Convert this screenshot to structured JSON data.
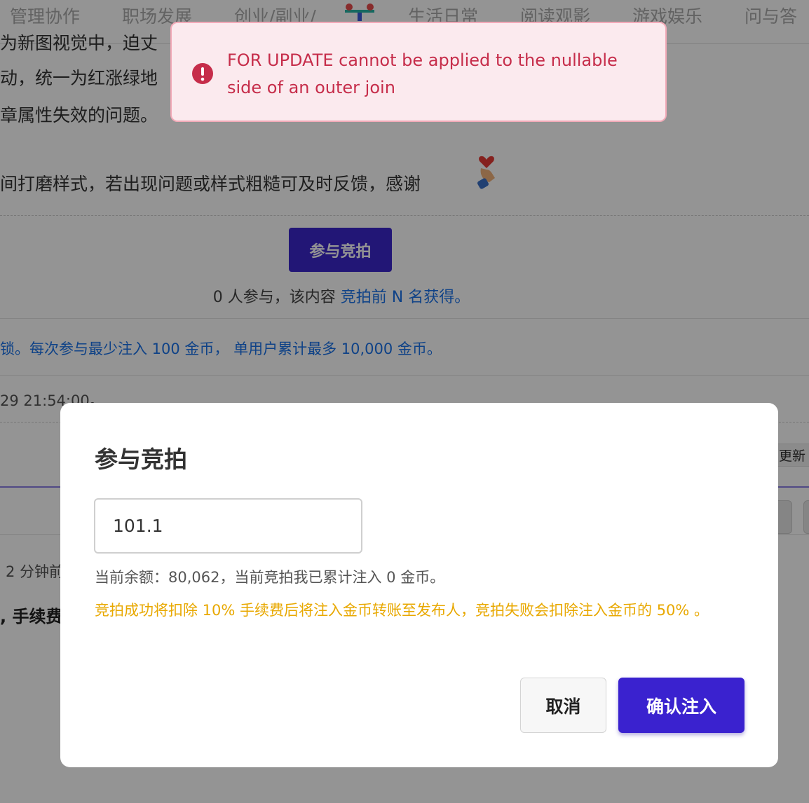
{
  "nav": {
    "items": [
      "管理协作",
      "职场发展",
      "创业/副业/",
      "生活日常",
      "阅读观影",
      "游戏娱乐",
      "问与答"
    ]
  },
  "article": {
    "line1": "为新图视觉中，迫丈",
    "line2": "动，统一为红涨绿地",
    "line3": "章属性失效的问题。",
    "line4": "间打磨样式，若出现问题或样式粗糙可及时反馈，感谢",
    "emoji": "heart-hand-icon"
  },
  "auction": {
    "button_label": "参与竞拍",
    "participants_prefix": "0 人参与，该内容",
    "participants_link": "竞拍前 N 名获得。",
    "rules": "锁。每次参与最少注入 100 金币， 单用户累计最多 10,000 金币。",
    "end_time": "29 21:54:00。"
  },
  "page_misc": {
    "update_tag": "更新",
    "time_ago": "2 分钟前",
    "fee_text": ", 手续费"
  },
  "toast": {
    "message": "FOR UPDATE cannot be applied to the nullable side of an outer join",
    "icon": "error-icon",
    "color": "#c62d4a"
  },
  "modal": {
    "title": "参与竞拍",
    "amount_value": "101.1",
    "balance_text": "当前余额：80,062，当前竞拍我已累计注入 0 金币。",
    "warning_text": "竞拍成功将扣除 10% 手续费后将注入金币转账至发布人，竞拍失败会扣除注入金币的 50% 。",
    "cancel_label": "取消",
    "confirm_label": "确认注入",
    "accent_color": "#3a22cf",
    "warning_color": "#e8a800"
  }
}
